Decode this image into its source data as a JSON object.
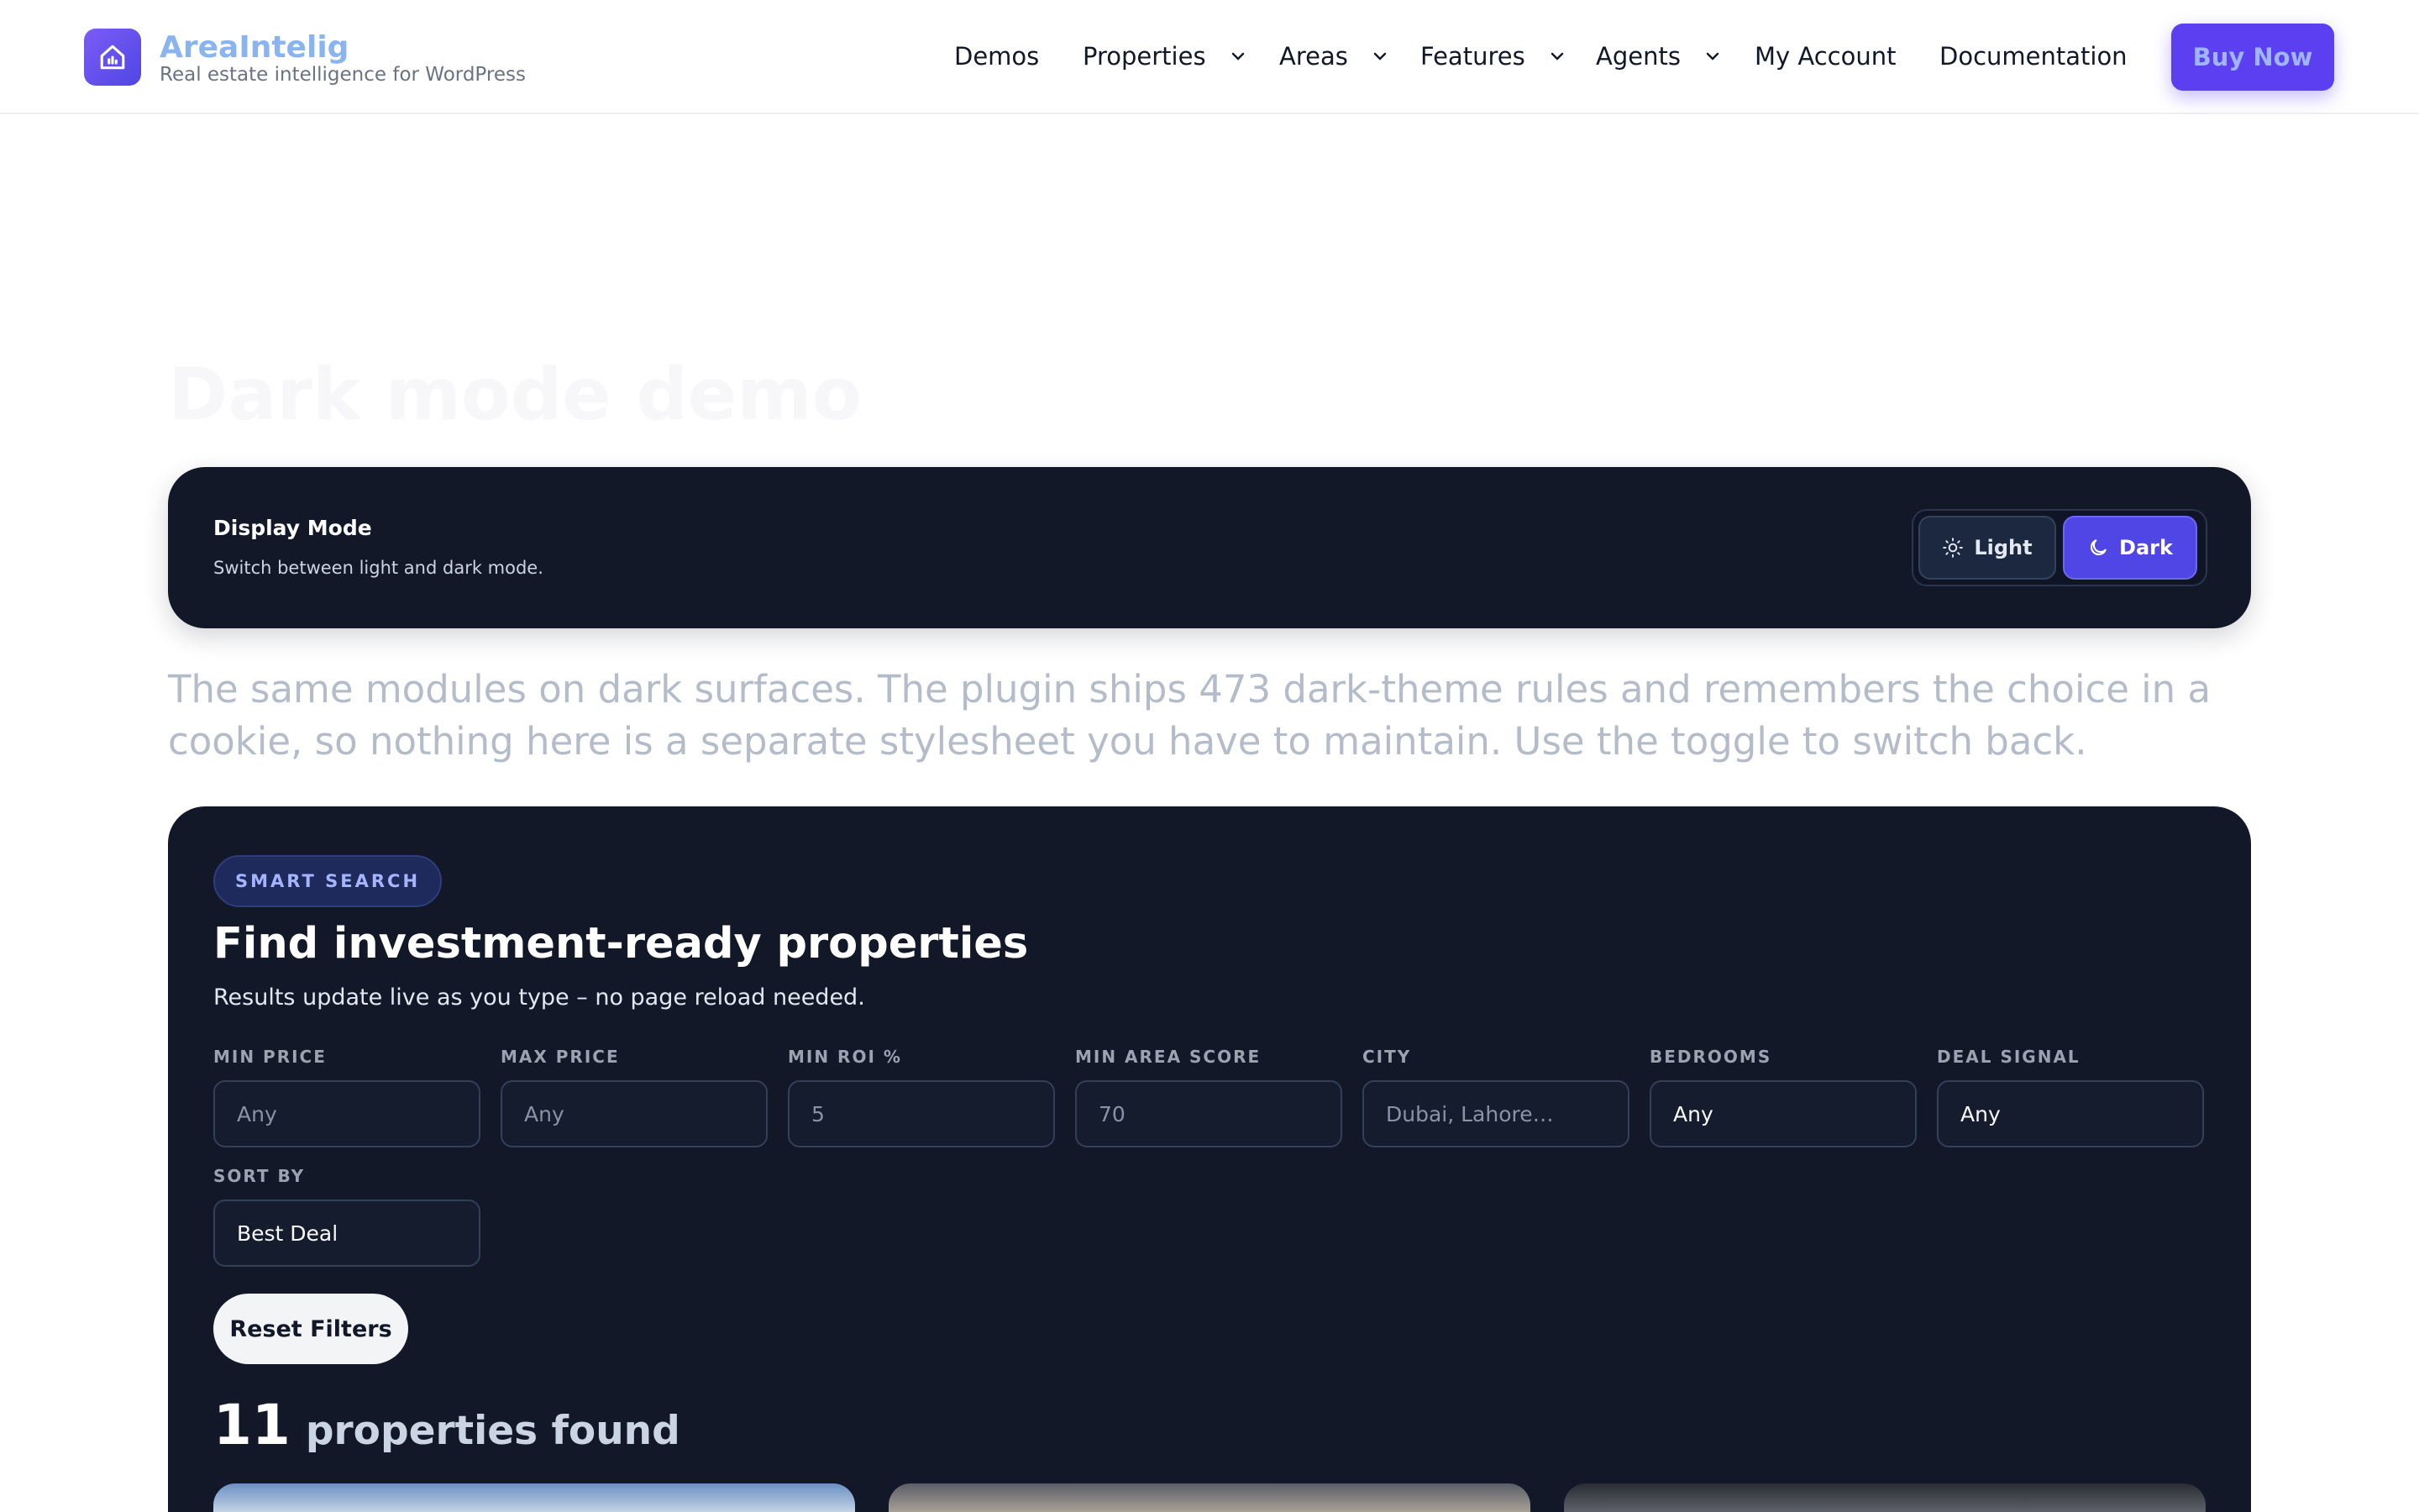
{
  "brand": {
    "name": "AreaIntelig",
    "tagline": "Real estate intelligence for WordPress"
  },
  "nav": {
    "items": [
      {
        "label": "Demos",
        "dropdown": false
      },
      {
        "label": "Properties",
        "dropdown": true
      },
      {
        "label": "Areas",
        "dropdown": true
      },
      {
        "label": "Features",
        "dropdown": true
      },
      {
        "label": "Agents",
        "dropdown": true
      },
      {
        "label": "My Account",
        "dropdown": false
      },
      {
        "label": "Documentation",
        "dropdown": false
      }
    ],
    "cta_label": "Buy Now"
  },
  "page": {
    "title": "Dark mode demo"
  },
  "display_mode": {
    "title": "Display Mode",
    "subtitle": "Switch between light and dark mode.",
    "light_label": "Light",
    "dark_label": "Dark",
    "active": "Dark"
  },
  "intro": "The same modules on dark surfaces. The plugin ships 473 dark-theme rules and remembers the choice in a cookie, so nothing here is a separate stylesheet you have to maintain. Use the toggle to switch back.",
  "search": {
    "badge": "SMART SEARCH",
    "title": "Find investment-ready properties",
    "subtitle": "Results update live as you type – no page reload needed.",
    "fields": [
      {
        "label": "MIN PRICE",
        "value": "",
        "placeholder": "Any"
      },
      {
        "label": "MAX PRICE",
        "value": "",
        "placeholder": "Any"
      },
      {
        "label": "MIN ROI %",
        "value": "",
        "placeholder": "5"
      },
      {
        "label": "MIN AREA SCORE",
        "value": "",
        "placeholder": "70"
      },
      {
        "label": "CITY",
        "value": "",
        "placeholder": "Dubai, Lahore…"
      },
      {
        "label": "BEDROOMS",
        "value": "Any",
        "placeholder": ""
      },
      {
        "label": "DEAL SIGNAL",
        "value": "Any",
        "placeholder": ""
      }
    ],
    "sort": {
      "label": "SORT BY",
      "value": "Best Deal"
    },
    "reset_label": "Reset Filters",
    "results_count": "11",
    "results_text": "properties found"
  },
  "colors": {
    "accent": "#5b3ff0",
    "card_bg": "#121827",
    "brand_text": "#8ab4f0"
  },
  "icons": [
    "home-icon",
    "chevron-down-icon",
    "sun-icon",
    "moon-icon"
  ]
}
